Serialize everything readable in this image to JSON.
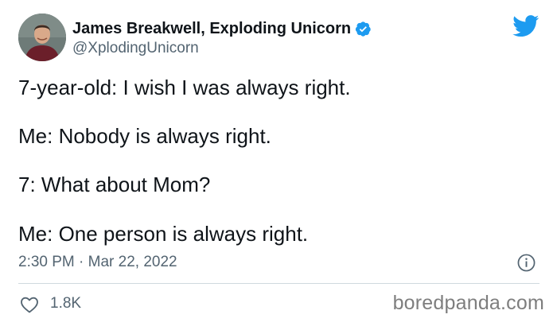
{
  "author": {
    "display_name": "James Breakwell, Exploding Unicorn",
    "handle": "@XplodingUnicorn",
    "verified": true
  },
  "tweet": {
    "lines": [
      "7-year-old: I wish I was always right.",
      "Me: Nobody is always right.",
      "7: What about Mom?",
      "Me: One person is always right."
    ],
    "timestamp": "2:30 PM · Mar 22, 2022",
    "like_count": "1.8K"
  },
  "watermark": "boredpanda.com",
  "icons": {
    "verified": "verified-badge-icon",
    "brand": "twitter-bird-icon",
    "info": "info-icon",
    "like": "heart-icon"
  },
  "colors": {
    "brand_blue": "#1d9bf0",
    "text_primary": "#0f1419",
    "text_secondary": "#536471",
    "divider": "#cfd9de",
    "watermark": "#7e7e7e"
  }
}
